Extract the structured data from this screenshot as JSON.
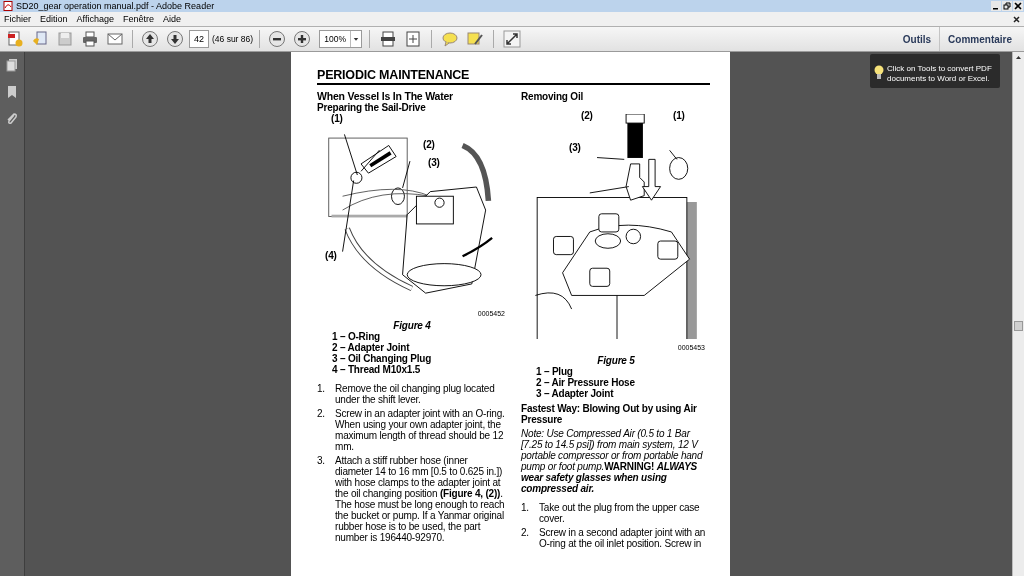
{
  "window": {
    "title": "SD20_gear operation manual.pdf - Adobe Reader"
  },
  "menu": [
    "Fichier",
    "Edition",
    "Affichage",
    "Fenêtre",
    "Aide"
  ],
  "toolbar": {
    "page_number": "42",
    "page_count": "(46 sur 86)",
    "zoom": "100%",
    "panels": [
      "Outils",
      "Commentaire"
    ]
  },
  "tooltip": {
    "text": "Click on Tools to convert PDF documents to Word or Excel."
  },
  "document": {
    "header": "PERIODIC MAINTENANCE",
    "left": {
      "heading": "When Vessel Is In The Water",
      "subheading": "Preparing the Sail-Drive",
      "figure": {
        "callouts": [
          "(1)",
          "(2)",
          "(3)",
          "(4)"
        ],
        "code": "0005452",
        "caption": "Figure 4"
      },
      "legend": [
        "1 – O-Ring",
        "2 – Adapter Joint",
        "3 – Oil Changing Plug",
        "4 – Thread M10x1.5"
      ],
      "steps": [
        {
          "number": "1.",
          "text": "Remove the oil changing plug located under the shift lever."
        },
        {
          "number": "2.",
          "text": "Screw in an adapter joint with an O-ring. When using your own adapter joint, the maximum length of thread should be 12 mm."
        },
        {
          "number": "3.",
          "text": "Attach a stiff rubber hose (inner diameter 14 to 16 mm [0.5 to 0.625 in.]) with hose clamps to the adapter joint at the oil changing position **(Figure 4, (2))**. The hose must be long enough to reach the bucket or pump. If a Yanmar original rubber hose is to be used, the part number is 196440-92970."
        }
      ]
    },
    "right": {
      "heading": "Removing Oil",
      "figure": {
        "callouts": [
          "(2)",
          "(1)",
          "(3)"
        ],
        "code": "0005453",
        "caption": "Figure 5"
      },
      "legend": [
        "1 – Plug",
        "2 – Air Pressure Hose",
        "3 – Adapter Joint"
      ],
      "subheading": "Fastest Way: Blowing Out by using Air Pressure",
      "note": {
        "text": "Note: Use Compressed Air (0.5 to 1 Bar [7.25 to 14.5 psi]) from main system, 12 V portable compressor or from portable hand pump or foot pump.",
        "warning": "WARNING!",
        "emphasis": "ALWAYS wear safety glasses when using compressed air."
      },
      "steps": [
        {
          "number": "1.",
          "text": "Take out the plug from the upper case cover."
        },
        {
          "number": "2.",
          "text": "Screw in a second adapter joint with an O-ring at the oil inlet position. Screw in"
        }
      ]
    }
  }
}
